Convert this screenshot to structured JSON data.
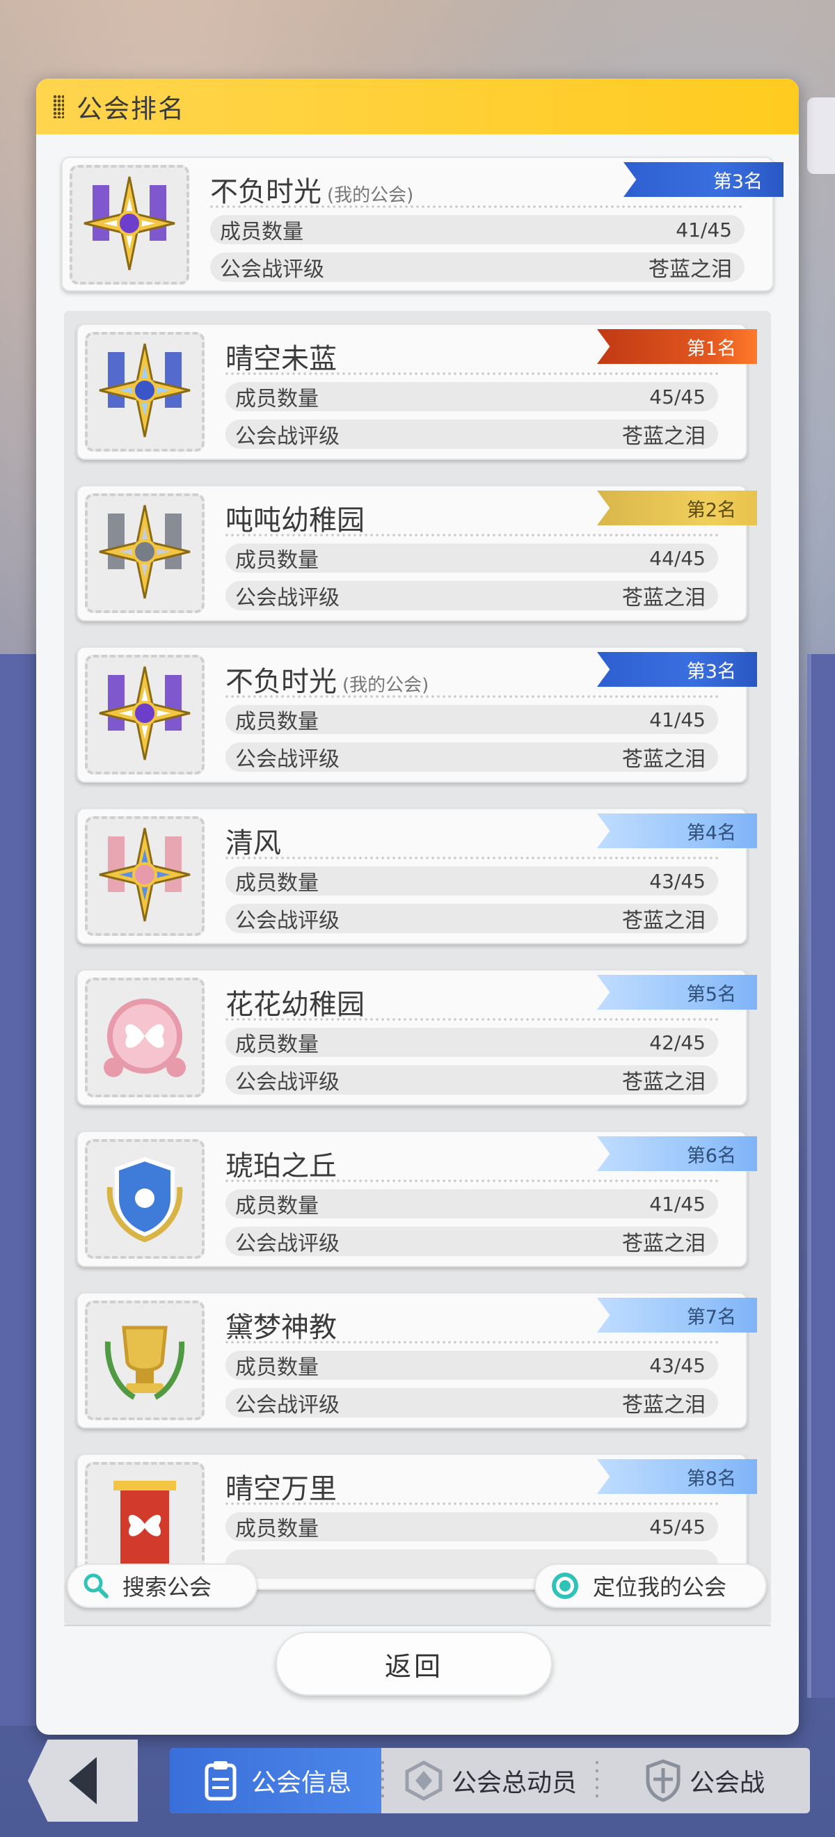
{
  "panel": {
    "title": "公会排名"
  },
  "my_guild": {
    "name": "不负时光",
    "mine_tag": "(我的公会)",
    "rank": "第3名",
    "rank_style": "blue",
    "members_label": "成员数量",
    "members": "41/45",
    "rating_label": "公会战评级",
    "rating": "苍蓝之泪",
    "emblem": "purple-banner-emblem"
  },
  "rankings": [
    {
      "name": "晴空未蓝",
      "mine_tag": "",
      "rank": "第1名",
      "rank_style": "red",
      "members_label": "成员数量",
      "members": "45/45",
      "rating_label": "公会战评级",
      "rating": "苍蓝之泪",
      "emblem": "blue-star-emblem"
    },
    {
      "name": "吨吨幼稚园",
      "mine_tag": "",
      "rank": "第2名",
      "rank_style": "gold",
      "members_label": "成员数量",
      "members": "44/45",
      "rating_label": "公会战评级",
      "rating": "苍蓝之泪",
      "emblem": "silver-wing-emblem"
    },
    {
      "name": "不负时光",
      "mine_tag": "(我的公会)",
      "rank": "第3名",
      "rank_style": "blue",
      "members_label": "成员数量",
      "members": "41/45",
      "rating_label": "公会战评级",
      "rating": "苍蓝之泪",
      "emblem": "purple-banner-emblem"
    },
    {
      "name": "清风",
      "mine_tag": "",
      "rank": "第4名",
      "rank_style": "light",
      "members_label": "成员数量",
      "members": "43/45",
      "rating_label": "公会战评级",
      "rating": "苍蓝之泪",
      "emblem": "rose-star-emblem"
    },
    {
      "name": "花花幼稚园",
      "mine_tag": "",
      "rank": "第5名",
      "rank_style": "light",
      "members_label": "成员数量",
      "members": "42/45",
      "rating_label": "公会战评级",
      "rating": "苍蓝之泪",
      "emblem": "butterfly-seal-emblem"
    },
    {
      "name": "琥珀之丘",
      "mine_tag": "",
      "rank": "第6名",
      "rank_style": "light",
      "members_label": "成员数量",
      "members": "41/45",
      "rating_label": "公会战评级",
      "rating": "苍蓝之泪",
      "emblem": "deer-shield-emblem"
    },
    {
      "name": "黛梦神教",
      "mine_tag": "",
      "rank": "第7名",
      "rank_style": "light",
      "members_label": "成员数量",
      "members": "43/45",
      "rating_label": "公会战评级",
      "rating": "苍蓝之泪",
      "emblem": "trophy-emblem"
    },
    {
      "name": "晴空万里",
      "mine_tag": "",
      "rank": "第8名",
      "rank_style": "light",
      "members_label": "成员数量",
      "members": "45/45",
      "rating_label": "",
      "rating": "",
      "emblem": "red-banner-emblem"
    }
  ],
  "controls": {
    "search_label": "搜索公会",
    "locate_label": "定位我的公会",
    "back_label": "返回"
  },
  "bottom_nav": {
    "tabs": [
      "公会信息",
      "公会总动员",
      "公会战"
    ],
    "active_tab": "公会信息"
  },
  "colors": {
    "header": "#ffcb1f",
    "rank1": "#e2571f",
    "rank2": "#f1cf5c",
    "rank3": "#3a6fe0",
    "rank_other": "#9cc8fb",
    "nav_active": "#3a6fd9"
  }
}
